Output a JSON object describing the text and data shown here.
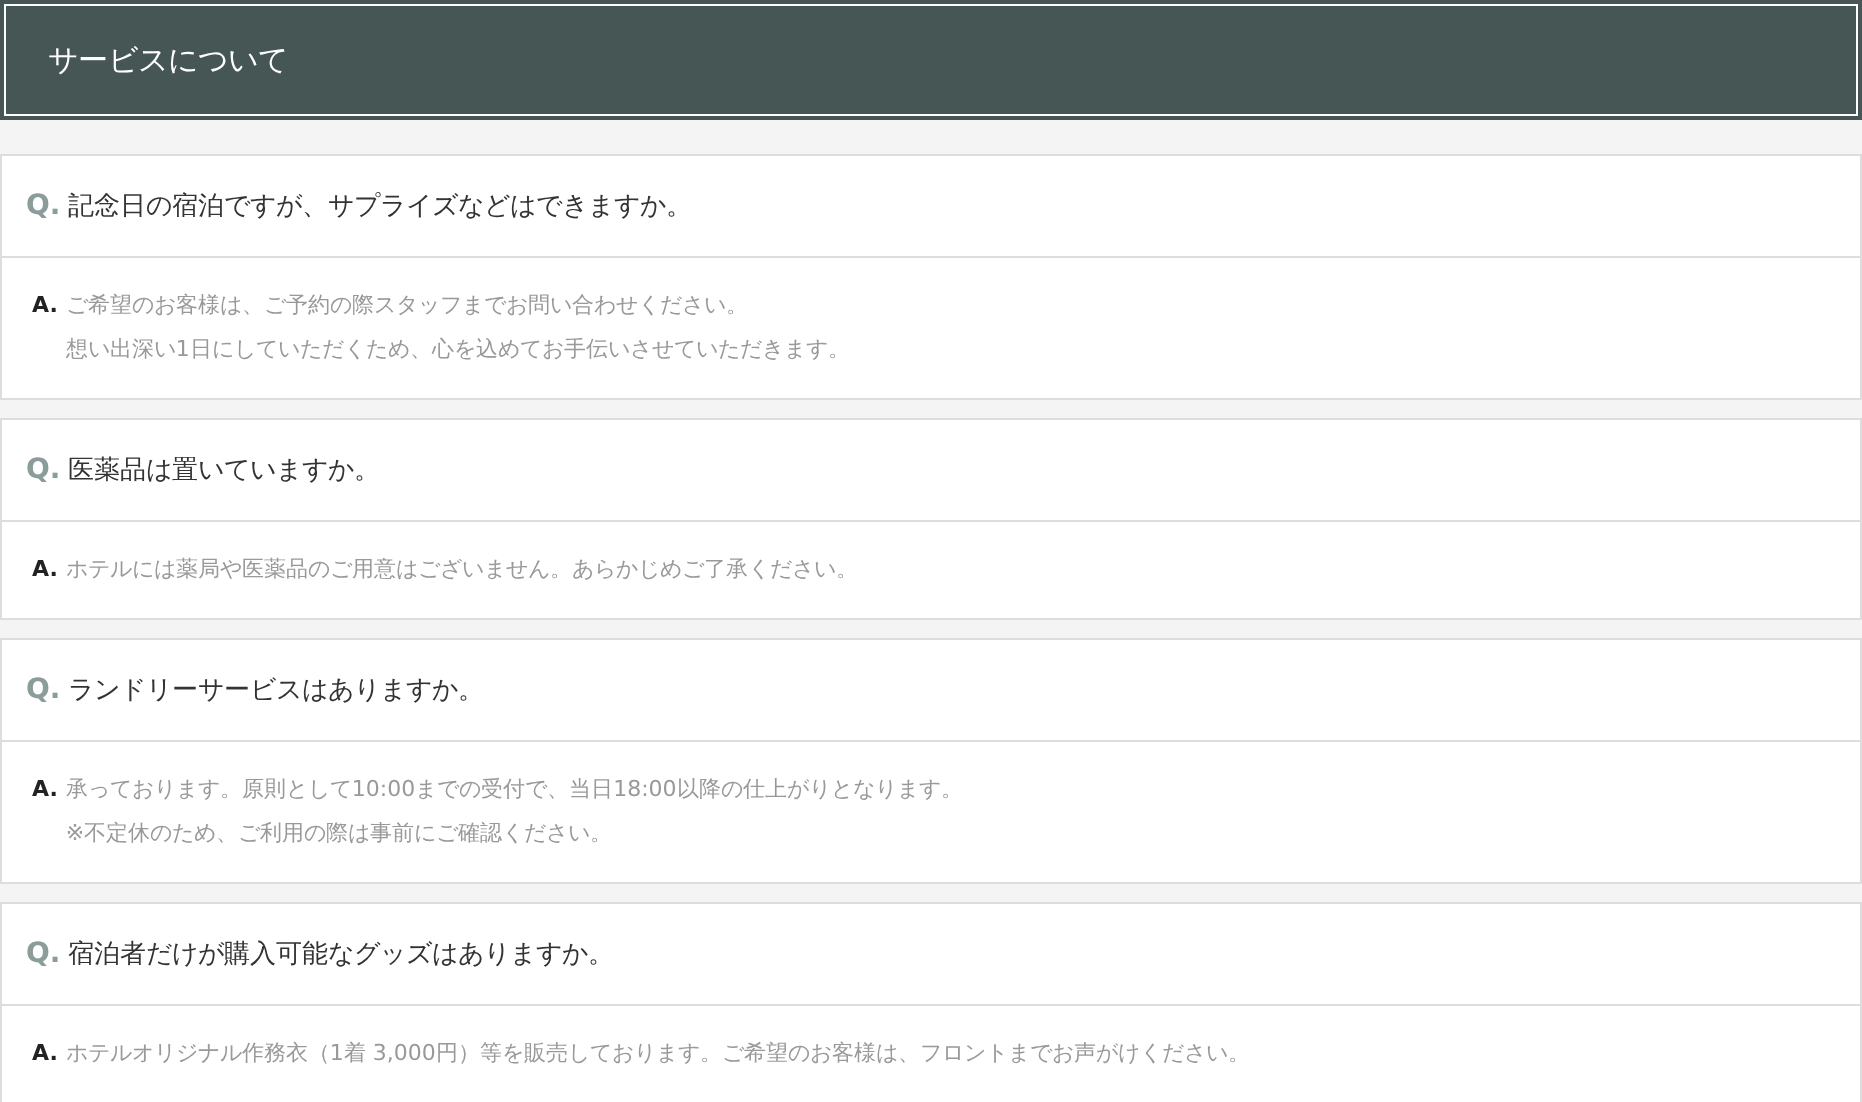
{
  "section": {
    "title": "サービスについて"
  },
  "faqs": [
    {
      "q_mark": "Q.",
      "question": "記念日の宿泊ですが、サプライズなどはできますか。",
      "a_mark": "A.",
      "answer_lines": [
        "ご希望のお客様は、ご予約の際スタッフまでお問い合わせください。",
        "想い出深い1日にしていただくため、心を込めてお手伝いさせていただきます。"
      ]
    },
    {
      "q_mark": "Q.",
      "question": "医薬品は置いていますか。",
      "a_mark": "A.",
      "answer_lines": [
        "ホテルには薬局や医薬品のご用意はございません。あらかじめご了承ください。"
      ]
    },
    {
      "q_mark": "Q.",
      "question": "ランドリーサービスはありますか。",
      "a_mark": "A.",
      "answer_lines": [
        "承っております。原則として10:00までの受付で、当日18:00以降の仕上がりとなります。",
        "※不定休のため、ご利用の際は事前にご確認ください。"
      ]
    },
    {
      "q_mark": "Q.",
      "question": "宿泊者だけが購入可能なグッズはありますか。",
      "a_mark": "A.",
      "answer_lines": [
        "ホテルオリジナル作務衣（1着 3,000円）等を販売しております。ご希望のお客様は、フロントまでお声がけください。"
      ]
    }
  ]
}
